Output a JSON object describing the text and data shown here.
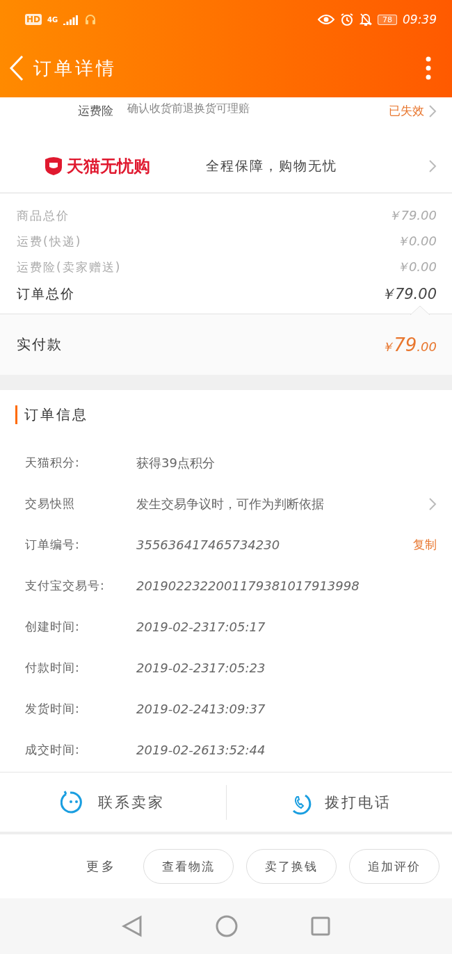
{
  "status_bar": {
    "hd": "HD",
    "network": "4G",
    "battery": "78",
    "time": "09:39"
  },
  "header": {
    "title": "订单详情"
  },
  "insurance": {
    "label": "运费险",
    "description": "确认收货前退换货可理赔",
    "status": "已失效"
  },
  "guarantee": {
    "brand": "天猫无忧购",
    "slogan": "全程保障，购物无忧"
  },
  "price_rows": [
    {
      "label": "商品总价",
      "value": "￥79.00",
      "kind": "minor"
    },
    {
      "label": "运费(快递)",
      "value": "￥0.00",
      "kind": "minor"
    },
    {
      "label": "运费险(卖家赠送)",
      "value": "￥0.00",
      "kind": "minor"
    },
    {
      "label": "订单总价",
      "value": "￥79.00",
      "kind": "total"
    }
  ],
  "paid": {
    "label": "实付款",
    "currency": "￥",
    "integer": "79",
    "decimals": ".00"
  },
  "order_info": {
    "title": "订单信息",
    "rows": [
      {
        "label": "天猫积分:",
        "value": "获得39点积分",
        "kind": "plain"
      },
      {
        "label": "交易快照",
        "value": "发生交易争议时，可作为判断依据",
        "kind": "link"
      },
      {
        "label": "订单编号:",
        "value": "355636417465734230",
        "kind": "copy",
        "action_text": "复制"
      },
      {
        "label": "支付宝交易号:",
        "value": "2019022322001179381017913998",
        "kind": "plain"
      },
      {
        "label": "创建时间:",
        "value": "2019-02-2317:05:17",
        "kind": "plain"
      },
      {
        "label": "付款时间:",
        "value": "2019-02-2317:05:23",
        "kind": "plain"
      },
      {
        "label": "发货时间:",
        "value": "2019-02-2413:09:37",
        "kind": "plain"
      },
      {
        "label": "成交时间:",
        "value": "2019-02-2613:52:44",
        "kind": "plain"
      }
    ]
  },
  "contact": [
    {
      "label": "联系卖家",
      "kind": "chat"
    },
    {
      "label": "拨打电话",
      "kind": "phone"
    }
  ],
  "actions": {
    "more": "更多",
    "buttons": [
      "查看物流",
      "卖了换钱",
      "追加评价"
    ]
  }
}
